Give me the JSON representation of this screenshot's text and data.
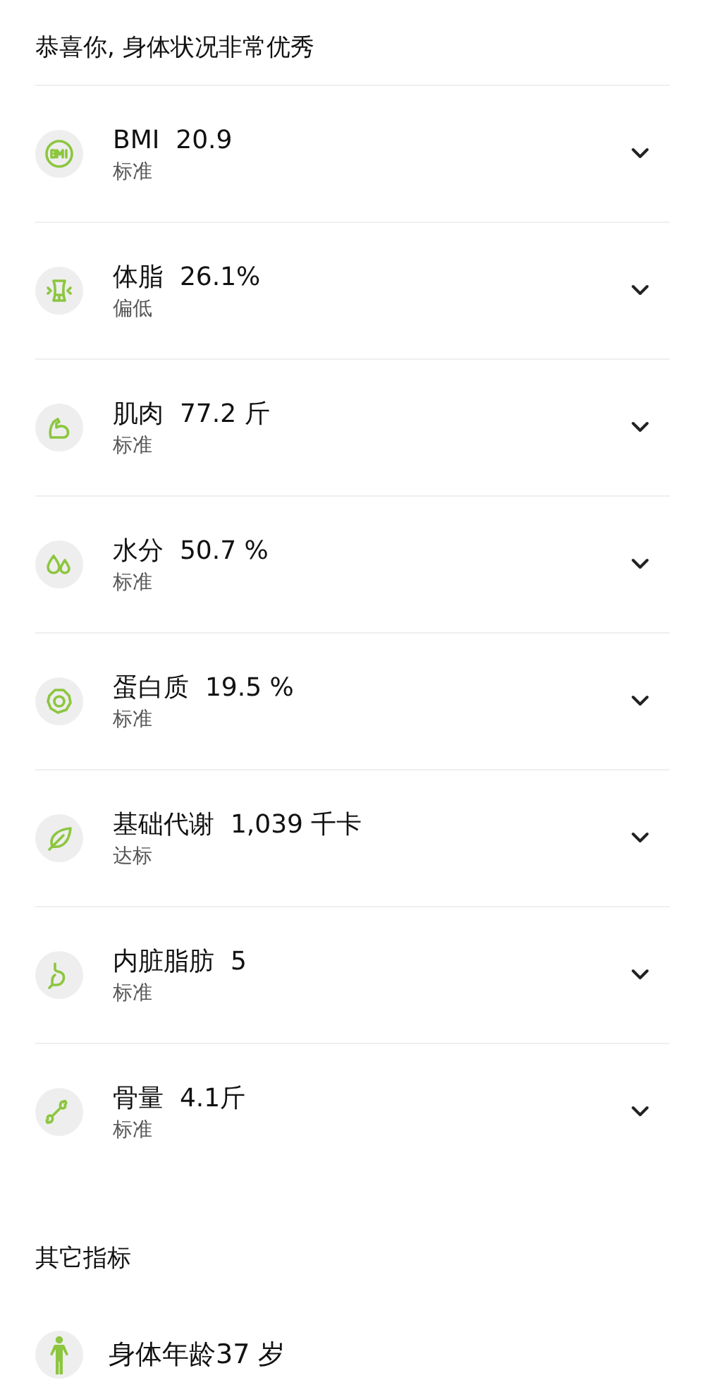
{
  "header": "恭喜你, 身体状况非常优秀",
  "metrics": [
    {
      "kind": "bmi",
      "name": "BMI",
      "value": "20.9",
      "status": "标准",
      "expanded": false
    },
    {
      "kind": "fat",
      "name": "体脂",
      "value": "26.1%",
      "status": "偏低",
      "expanded": false
    },
    {
      "kind": "muscle",
      "name": "肌肉",
      "value": "77.2 斤",
      "status": "标准",
      "expanded": false
    },
    {
      "kind": "water",
      "name": "水分",
      "value": "50.7 %",
      "status": "标准",
      "expanded": false
    },
    {
      "kind": "protein",
      "name": "蛋白质",
      "value": "19.5 %",
      "status": "标准",
      "expanded": false
    },
    {
      "kind": "metabolism",
      "name": "基础代谢",
      "value": "1,039 千卡",
      "status": "达标",
      "expanded": false
    },
    {
      "kind": "visceral",
      "name": "内脏脂肪",
      "value": "5",
      "status": "标准",
      "expanded": false
    },
    {
      "kind": "bone",
      "name": "骨量",
      "value": "4.1斤",
      "status": "标准",
      "expanded": false
    }
  ],
  "other_section": {
    "title": "其它指标",
    "items": [
      {
        "kind": "age",
        "label": "身体年龄37 岁"
      }
    ]
  }
}
